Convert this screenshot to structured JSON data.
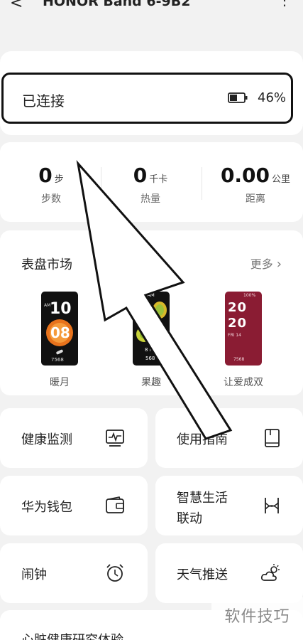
{
  "header": {
    "back_icon": "back-arrow-icon",
    "title": "HONOR Band 6-9B2",
    "more_icon": "more-icon"
  },
  "connection": {
    "status": "已连接",
    "battery_icon": "battery-icon",
    "battery": "46%"
  },
  "stats": [
    {
      "value": "0",
      "unit": "步",
      "label": "步数"
    },
    {
      "value": "0",
      "unit": "千卡",
      "label": "热量"
    },
    {
      "value": "0.00",
      "unit": "公里",
      "label": "距离"
    }
  ],
  "faces": {
    "title": "表盘市场",
    "more": "更多",
    "items": [
      {
        "label": "暖月",
        "time_top": "10",
        "time_bottom": "08",
        "am": "AM",
        "steps": "7568"
      },
      {
        "label": "果趣",
        "am": "AM",
        "hour": "10",
        "date": "8 FRI",
        "steps": "568"
      },
      {
        "label": "让爱成双",
        "top_digits": "20",
        "bottom_digits": "20",
        "date": "FRI 14",
        "steps": "7568",
        "battery": "100%"
      }
    ]
  },
  "tiles": [
    {
      "label": "健康监测",
      "icon": "health-monitor-icon"
    },
    {
      "label": "使用指南",
      "icon": "guide-book-icon"
    },
    {
      "label": "华为钱包",
      "icon": "wallet-icon"
    },
    {
      "label_line1": "智慧生活",
      "label_line2": "联动",
      "icon": "smart-link-icon"
    },
    {
      "label": "闹钟",
      "icon": "alarm-clock-icon"
    },
    {
      "label": "天气推送",
      "icon": "weather-icon"
    }
  ],
  "partial": {
    "label": "心脏健康研究体验"
  },
  "watermark": {
    "text": "软件技巧"
  },
  "colors": {
    "background": "#f2f2f2",
    "card": "#ffffff",
    "face_red": "#8a1c33",
    "face_orange": "#e8731c"
  }
}
